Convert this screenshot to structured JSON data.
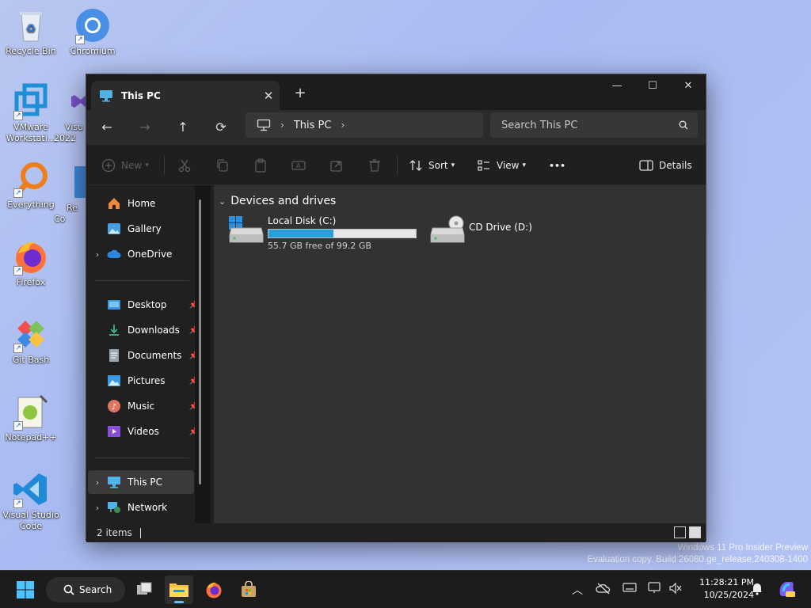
{
  "desktop": {
    "icons": [
      {
        "label": "Recycle Bin",
        "icon": "recycle-bin-icon"
      },
      {
        "label": "Chromium",
        "icon": "chromium-icon"
      },
      {
        "label": "VMware Workstati...",
        "icon": "vmware-icon"
      },
      {
        "label": "Visu 2022",
        "icon": "visual-studio-icon"
      },
      {
        "label": "Everything",
        "icon": "everything-icon"
      },
      {
        "label": "Re Co",
        "icon": "app-icon"
      },
      {
        "label": "Firefox",
        "icon": "firefox-icon"
      },
      {
        "label": "Git Bash",
        "icon": "git-bash-icon"
      },
      {
        "label": "Notepad++",
        "icon": "notepad-plus-plus-icon"
      },
      {
        "label": "Visual Studio Code",
        "icon": "vscode-icon"
      }
    ],
    "watermark_line1": "Windows 11 Pro Insider Preview",
    "watermark_line2": "Evaluation copy. Build 26080.ge_release.240308-1400"
  },
  "window": {
    "tab_title": "This PC",
    "tab_close": "✕",
    "new_tab": "+",
    "minimize": "—",
    "maximize": "☐",
    "close": "✕",
    "nav": {
      "back": "←",
      "forward": "→",
      "up": "↑",
      "refresh": "⟳"
    },
    "address": {
      "crumb": "This PC",
      "sep": "›"
    },
    "search_placeholder": "Search This PC",
    "toolbar": {
      "new_label": "New",
      "sort_label": "Sort",
      "view_label": "View",
      "more_label": "•••",
      "details_label": "Details"
    },
    "sidebar": {
      "home": "Home",
      "gallery": "Gallery",
      "onedrive": "OneDrive",
      "desktop": "Desktop",
      "downloads": "Downloads",
      "documents": "Documents",
      "pictures": "Pictures",
      "music": "Music",
      "videos": "Videos",
      "this_pc": "This PC",
      "network": "Network"
    },
    "main": {
      "group_title": "Devices and drives",
      "drives": [
        {
          "name": "Local Disk (C:)",
          "free_text": "55.7 GB free of 99.2 GB",
          "used_fraction": 0.44
        },
        {
          "name": "CD Drive (D:)"
        }
      ]
    },
    "status": {
      "item_count": "2 items"
    }
  },
  "taskbar": {
    "search_label": "Search",
    "time": "11:28:21 PM",
    "date": "10/25/2024"
  },
  "colors": {
    "accent": "#26a0da",
    "window_bg": "#202020",
    "main_bg": "#323232"
  }
}
